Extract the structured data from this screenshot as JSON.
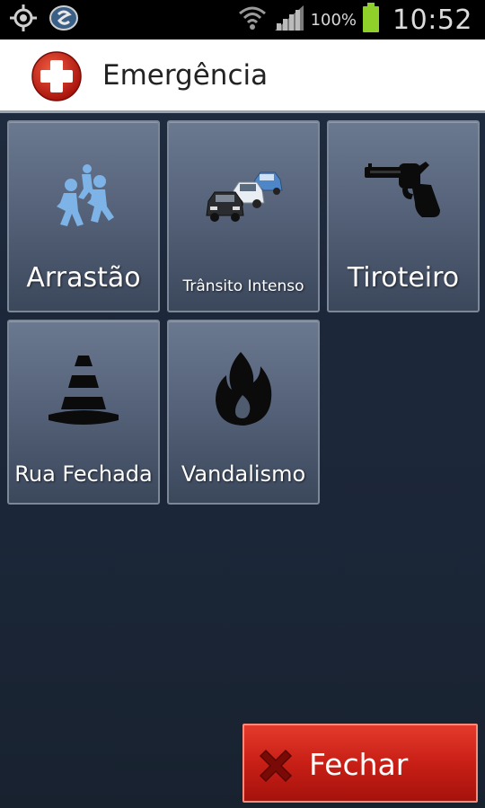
{
  "status_bar": {
    "left_icons": [
      "gps-icon",
      "carrier-logo-icon"
    ],
    "right_icons": [
      "wifi-icon",
      "signal-icon",
      "battery-icon"
    ],
    "battery_percent": "100%",
    "time": "10:52"
  },
  "header": {
    "icon": "red-cross-icon",
    "title": "Emergência"
  },
  "tiles": [
    {
      "label": "Arrastão",
      "icon": "people-running-icon"
    },
    {
      "label": "Trânsito Intenso",
      "icon": "traffic-cars-icon"
    },
    {
      "label": "Tiroteiro",
      "icon": "revolver-icon"
    },
    {
      "label": "Rua Fechada",
      "icon": "traffic-cone-icon"
    },
    {
      "label": "Vandalismo",
      "icon": "fire-icon"
    }
  ],
  "close_button": {
    "label": "Fechar",
    "icon": "red-x-icon"
  },
  "colors": {
    "accent_red": "#c81f16",
    "tile_top": "#6b7990",
    "tile_bottom": "#3b475b",
    "background": "#1b2638"
  }
}
